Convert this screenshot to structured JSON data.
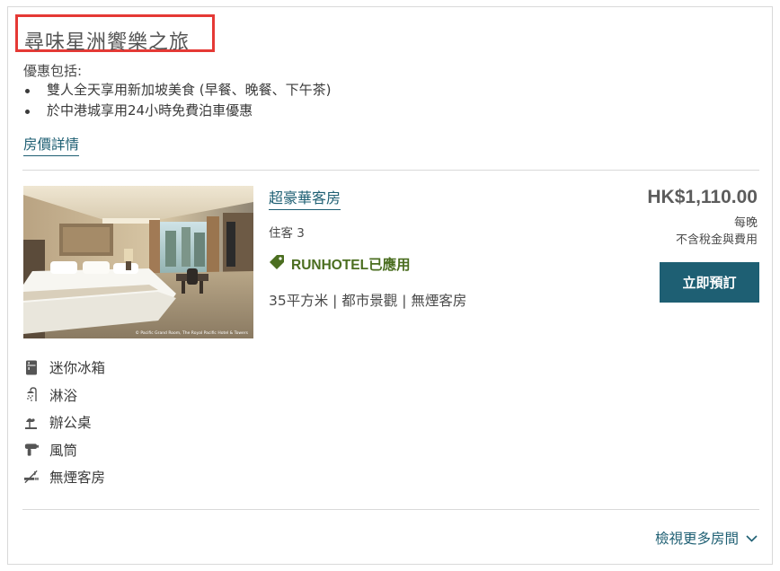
{
  "offer": {
    "title": "尋味星洲饗樂之旅",
    "includes_heading": "優惠包括:",
    "items": [
      "雙人全天享用新加坡美食 (早餐、晚餐、下午茶)",
      "於中港城享用24小時免費泊車優惠"
    ],
    "rate_details_link": "房價詳情"
  },
  "room": {
    "name": "超豪華客房",
    "guests": "住客 3",
    "promo_label": "RUNHOTEL已應用",
    "features_line": "35平方米 | 都市景觀 | 無煙客房",
    "photo_caption": "© Pacific Grand Room, The Royal Pacific Hotel & Towers",
    "price": "HK$1,110.00",
    "per_night": "每晚",
    "tax_note": "不含稅金與費用",
    "book_button": "立即預訂",
    "amenities": [
      {
        "icon": "mini-fridge-icon",
        "label": "迷你冰箱"
      },
      {
        "icon": "shower-icon",
        "label": "淋浴"
      },
      {
        "icon": "desk-lamp-icon",
        "label": "辦公桌"
      },
      {
        "icon": "hair-dryer-icon",
        "label": "風筒"
      },
      {
        "icon": "no-smoking-icon",
        "label": "無煙客房"
      }
    ]
  },
  "footer": {
    "view_more_rooms": "檢視更多房間"
  },
  "colors": {
    "link": "#1e5f73",
    "promo_green": "#4b6e20",
    "highlight_border": "#e53935",
    "button_bg": "#1e5f73"
  }
}
